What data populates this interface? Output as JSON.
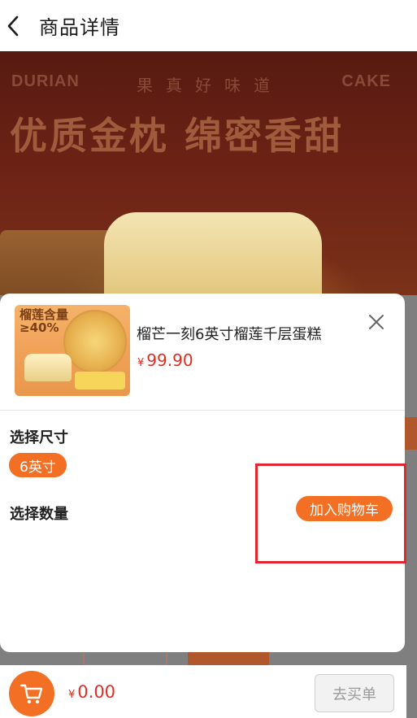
{
  "header": {
    "title": "商品详情",
    "back_icon": "chevron-left-icon"
  },
  "banner": {
    "brand_left": "DURIAN",
    "brand_tagline": "果真好味道",
    "brand_right": "CAKE",
    "slogan": "优质金枕 绵密香甜"
  },
  "sheet": {
    "product_name": "榴芒一刻6英寸榴莲千层蛋糕",
    "currency": "¥",
    "price": "99.90",
    "thumbnail_text": "榴莲含量≥40%",
    "size_label": "选择尺寸",
    "size_option": "6英寸",
    "quantity_label": "选择数量",
    "add_to_cart": "加入购物车",
    "close_icon": "close-icon"
  },
  "footer": {
    "cart_icon": "cart-icon",
    "currency": "¥",
    "total": "0.00",
    "checkout": "去买单"
  },
  "colors": {
    "accent": "#f36f23",
    "price": "#e02e24",
    "highlight": "#e0262e"
  }
}
